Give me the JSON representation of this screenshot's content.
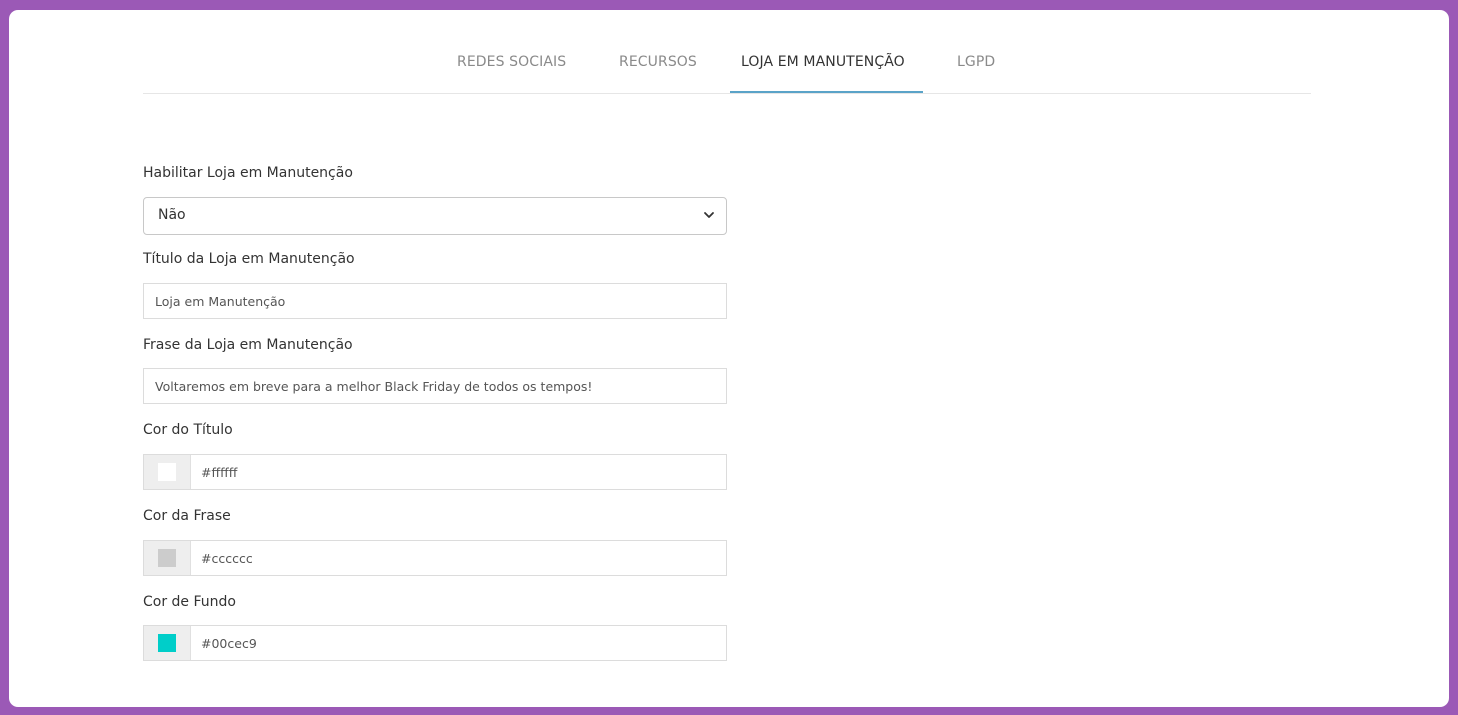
{
  "tabs": [
    {
      "label": "REDES SOCIAIS",
      "active": false
    },
    {
      "label": "RECURSOS",
      "active": false
    },
    {
      "label": "LOJA EM MANUTENÇÃO",
      "active": true
    },
    {
      "label": "LGPD",
      "active": false
    }
  ],
  "form": {
    "enable": {
      "label": "Habilitar Loja em Manutenção",
      "value": "Não"
    },
    "title": {
      "label": "Título da Loja em Manutenção",
      "value": "Loja em Manutenção"
    },
    "phrase": {
      "label": "Frase da Loja em Manutenção",
      "value": "Voltaremos em breve para a melhor Black Friday de todos os tempos!"
    },
    "title_color": {
      "label": "Cor do Título",
      "value": "#ffffff",
      "swatch": "#ffffff"
    },
    "phrase_color": {
      "label": "Cor da Frase",
      "value": "#cccccc",
      "swatch": "#cccccc"
    },
    "background_color": {
      "label": "Cor de Fundo",
      "value": "#00cec9",
      "swatch": "#00cec9"
    }
  },
  "colors": {
    "frame": "#9b59b6",
    "active_tab_underline": "#5aa3c8"
  }
}
